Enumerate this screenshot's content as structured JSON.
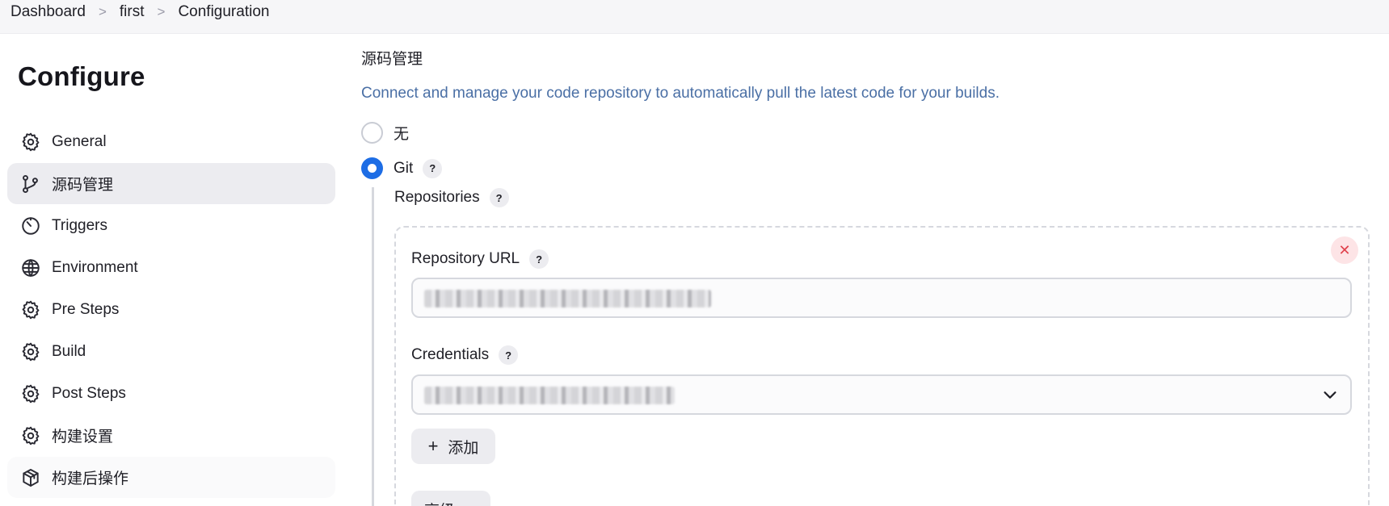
{
  "breadcrumb": {
    "items": [
      "Dashboard",
      "first",
      "Configuration"
    ],
    "separator": ">"
  },
  "sidebar": {
    "title": "Configure",
    "items": [
      {
        "label": "General",
        "icon": "gear-icon"
      },
      {
        "label": "源码管理",
        "icon": "branch-icon",
        "active": true
      },
      {
        "label": "Triggers",
        "icon": "timer-icon"
      },
      {
        "label": "Environment",
        "icon": "globe-icon"
      },
      {
        "label": "Pre Steps",
        "icon": "gear-icon"
      },
      {
        "label": "Build",
        "icon": "gear-icon"
      },
      {
        "label": "Post Steps",
        "icon": "gear-icon"
      },
      {
        "label": "构建设置",
        "icon": "gear-icon"
      },
      {
        "label": "构建后操作",
        "icon": "package-icon"
      }
    ]
  },
  "main": {
    "section_title": "源码管理",
    "section_desc": "Connect and manage your code repository to automatically pull the latest code for your builds.",
    "scm_options": [
      {
        "label": "无",
        "selected": false
      },
      {
        "label": "Git",
        "selected": true
      }
    ],
    "help_symbol": "?",
    "repositories_label": "Repositories",
    "repo": {
      "url_label": "Repository URL",
      "url_value": "",
      "credentials_label": "Credentials",
      "credentials_value": "",
      "close_symbol": "✕"
    },
    "add_button": {
      "icon": "+",
      "label": "添加"
    },
    "advanced_button": {
      "label": "高级"
    }
  },
  "colors": {
    "accent": "#1d6de5",
    "description": "#4a6fa5",
    "danger": "#e0424d",
    "danger_bg": "#fde4e6"
  }
}
